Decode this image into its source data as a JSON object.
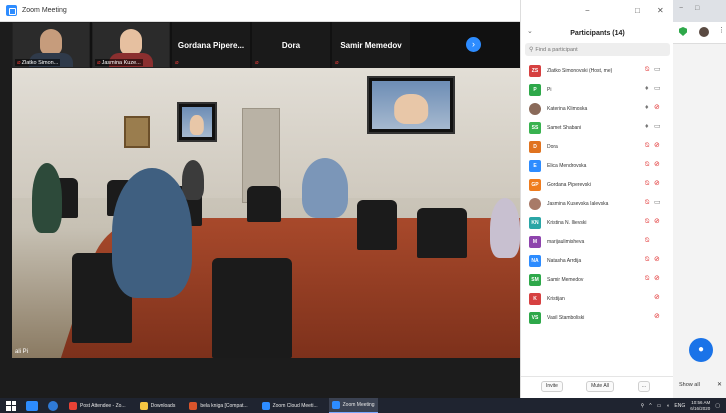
{
  "window": {
    "title": "Zoom Meeting"
  },
  "video_strip": {
    "thumbs": [
      {
        "label": "Zlatko Simon...",
        "skin": "#c69c7c",
        "shirt": "#2f3a4a"
      },
      {
        "label": "Jasmina Kuze...",
        "skin": "#e6c0a0",
        "shirt": "#8b2f2f"
      }
    ],
    "name_tiles": [
      "Gordana Pipere...",
      "Dora",
      "Samir Memedov"
    ]
  },
  "main_video": {
    "self_label": "ali Pi"
  },
  "panel": {
    "title": "Participants (14)",
    "search_placeholder": "Find a participant",
    "window_controls": [
      "−",
      "□",
      "✕"
    ],
    "participants": [
      {
        "initials": "ZS",
        "name": "Zlatko Simonovski (Host, me)",
        "color": "#d64141",
        "mic": "muted",
        "cam": "on"
      },
      {
        "initials": "P",
        "name": "Pi",
        "color": "#2ea84a",
        "mic": "on",
        "cam": "on"
      },
      {
        "initials": "",
        "name": "Katerina Klimoska",
        "color": "#8a6a5a",
        "mic": "on",
        "cam": "off",
        "photo": true
      },
      {
        "initials": "SS",
        "name": "Samet Shabani",
        "color": "#38b24f",
        "mic": "on",
        "cam": "on"
      },
      {
        "initials": "D",
        "name": "Dora",
        "color": "#e0731f",
        "mic": "muted",
        "cam": "off"
      },
      {
        "initials": "E",
        "name": "Elica Mendrovska",
        "color": "#2d8cff",
        "mic": "muted",
        "cam": "off"
      },
      {
        "initials": "GP",
        "name": "Gordana Piperevski",
        "color": "#ef7c1e",
        "mic": "muted",
        "cam": "off"
      },
      {
        "initials": "",
        "name": "Jasmina Kusevska Ialevska",
        "color": "#a87a68",
        "mic": "muted",
        "cam": "on",
        "photo": true
      },
      {
        "initials": "KN",
        "name": "Kristina N. Ilievski",
        "color": "#2aa6a6",
        "mic": "muted",
        "cam": "off"
      },
      {
        "initials": "M",
        "name": "marijaulimisheva",
        "color": "#8e44ad",
        "mic": "muted",
        "cam": ""
      },
      {
        "initials": "NA",
        "name": "Natasha Arrdija",
        "color": "#2d8cff",
        "mic": "muted",
        "cam": "off"
      },
      {
        "initials": "SM",
        "name": "Samir Memedov",
        "color": "#2ea84a",
        "mic": "muted",
        "cam": "off"
      },
      {
        "initials": "K",
        "name": "Kristijan",
        "color": "#d64141",
        "mic": "",
        "cam": "off"
      },
      {
        "initials": "VS",
        "name": "Vasil Stamboliski",
        "color": "#2ea84a",
        "mic": "",
        "cam": "off"
      }
    ],
    "footer": {
      "invite": "Invite",
      "mute_all": "Mute All",
      "more": "..."
    }
  },
  "browser_remnant": {
    "show_all": "Show all",
    "close": "✕"
  },
  "taskbar": {
    "items": [
      {
        "label": "Post Attendee - Zo...",
        "color": "#e94235",
        "active": false
      },
      {
        "label": "Downloads",
        "color": "#f4c542",
        "active": false
      },
      {
        "label": "bela kniga [Compat...",
        "color": "#d9542b",
        "active": false
      },
      {
        "label": "Zoom Cloud Meeti...",
        "color": "#2d8cff",
        "active": false
      },
      {
        "label": "Zoom Meeting",
        "color": "#2d8cff",
        "active": true
      }
    ],
    "lang": "ENG",
    "time": "10:56 AM",
    "date": "6/16/2020"
  }
}
